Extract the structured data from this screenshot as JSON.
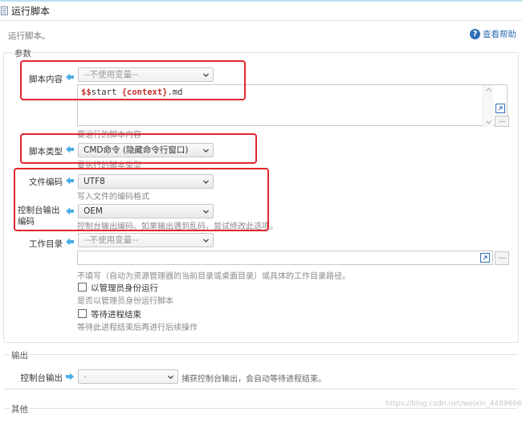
{
  "header": {
    "title": "运行脚本",
    "subtitle": "运行脚本。",
    "help_label": "查看帮助",
    "help_glyph": "?"
  },
  "params": {
    "legend": "参数",
    "content": {
      "label": "脚本内容",
      "variable_select": "--不使用变量--",
      "code_prefix": "$$",
      "code_start": "start ",
      "code_var": "{context}",
      "code_suffix": ".md",
      "hint": "要运行的脚本内容",
      "more_button": "..."
    },
    "type": {
      "label": "脚本类型",
      "value": "CMD命令 (隐藏命令行窗口)",
      "hint": "要执行的脚本类型"
    },
    "file_encoding": {
      "label": "文件编码",
      "value": "UTF8",
      "hint": "写入文件的编码格式"
    },
    "console_encoding": {
      "label_line1": "控制台输出",
      "label_line2": "编码",
      "value": "OEM",
      "hint": "控制台输出编码。如果输出遇到乱码，尝试修改此选项。"
    },
    "workdir": {
      "label": "工作目录",
      "variable_select": "--不使用变量--",
      "more_button": "...",
      "hint": "不填写（自动为资源管理器的当前目录或桌面目录）或具体的工作目录路径。"
    },
    "run_as_admin": {
      "label": "以管理员身份运行",
      "hint": "是否以管理员身份运行脚本"
    },
    "wait_exit": {
      "label": "等待进程结束",
      "hint": "等待此进程结束后再进行后续操作"
    }
  },
  "output": {
    "legend": "输出",
    "console_output": {
      "label": "控制台输出",
      "value": "-",
      "hint": "捕获控制台输出，会自动等待进程结束。"
    }
  },
  "other": {
    "legend": "其他"
  },
  "watermark": "https://blog.csdn.net/weixin_44896665",
  "colors": {
    "accent": "#2d6fb7",
    "arrow": "#4aaee8",
    "highlight": "#e3262d",
    "code_variable": "#c4302b"
  }
}
